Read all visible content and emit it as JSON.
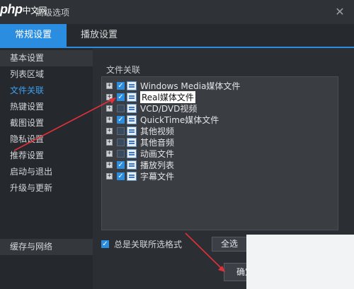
{
  "window": {
    "logo_text": "php",
    "logo_suffix": "中文网",
    "title": "高级选项",
    "close_glyph": "✕"
  },
  "tabs": [
    {
      "label": "常规设置",
      "active": true
    },
    {
      "label": "播放设置",
      "active": false
    }
  ],
  "sidebar": {
    "items": [
      {
        "label": "基本设置"
      },
      {
        "label": "列表区域"
      },
      {
        "label": "文件关联",
        "active": true
      },
      {
        "label": "热键设置"
      },
      {
        "label": "截图设置"
      },
      {
        "label": "隐私设置"
      },
      {
        "label": "推荐设置"
      },
      {
        "label": "启动与退出"
      },
      {
        "label": "升级与更新"
      }
    ],
    "bottom_item": {
      "label": "缓存与网络"
    }
  },
  "file_assoc": {
    "group_label": "文件关联",
    "rows": [
      {
        "label": "Windows Media媒体文件",
        "checked": true,
        "selected": false
      },
      {
        "label": "Real媒体文件",
        "checked": true,
        "selected": true
      },
      {
        "label": "VCD/DVD视频",
        "checked": false,
        "selected": false
      },
      {
        "label": "QuickTime媒体文件",
        "checked": true,
        "selected": false
      },
      {
        "label": "其他视频",
        "checked": false,
        "selected": false
      },
      {
        "label": "其他音频",
        "checked": false,
        "selected": false
      },
      {
        "label": "动画文件",
        "checked": false,
        "selected": false
      },
      {
        "label": "播放列表",
        "checked": true,
        "selected": false
      },
      {
        "label": "字幕文件",
        "checked": true,
        "selected": false
      }
    ],
    "always_assoc_label": "总是关联所选格式",
    "always_assoc_checked": true,
    "select_all_label": "全选",
    "select_none_label": ""
  },
  "footer": {
    "ok_label": "确定",
    "cancel_label": ""
  },
  "colors": {
    "accent": "#2a8de0",
    "annotation_arrow": "#e0303a"
  }
}
